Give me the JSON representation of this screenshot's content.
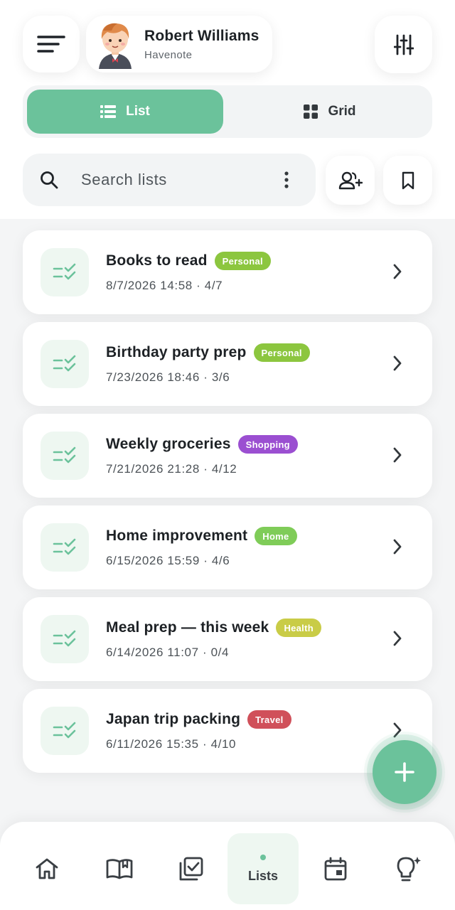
{
  "header": {
    "profile_name": "Robert Williams",
    "profile_subtitle": "Havenote",
    "icons": {
      "menu": "menu-icon",
      "filter": "sliders-icon",
      "avatar": "avatar-illustration"
    }
  },
  "view_toggle": {
    "list_label": "List",
    "grid_label": "Grid",
    "selected": "List",
    "accent_color": "#6bc29b"
  },
  "search": {
    "placeholder": "Search lists"
  },
  "lists": [
    {
      "title": "Books to read",
      "tag": "Personal",
      "tag_color": "#8cc63f",
      "date": "8/7/2026 14:58",
      "progress": "4/7"
    },
    {
      "title": "Birthday party prep",
      "tag": "Personal",
      "tag_color": "#8cc63f",
      "date": "7/23/2026 18:46",
      "progress": "3/6"
    },
    {
      "title": "Weekly groceries",
      "tag": "Shopping",
      "tag_color": "#9b4fd1",
      "date": "7/21/2026 21:28",
      "progress": "4/12"
    },
    {
      "title": "Home improvement",
      "tag": "Home",
      "tag_color": "#7fcc58",
      "date": "6/15/2026 15:59",
      "progress": "4/6"
    },
    {
      "title": "Meal prep — this week",
      "tag": "Health",
      "tag_color": "#c9cc47",
      "date": "6/14/2026 11:07",
      "progress": "0/4"
    },
    {
      "title": "Japan trip packing",
      "tag": "Travel",
      "tag_color": "#d0505a",
      "date": "6/11/2026 15:35",
      "progress": "4/10"
    }
  ],
  "bottom_nav": {
    "items": [
      {
        "icon": "home-icon"
      },
      {
        "icon": "book-icon"
      },
      {
        "icon": "checkbox-icon"
      },
      {
        "icon": "list-icon",
        "label": "Lists",
        "active": true
      },
      {
        "icon": "calendar-icon"
      },
      {
        "icon": "lightbulb-icon"
      }
    ]
  }
}
